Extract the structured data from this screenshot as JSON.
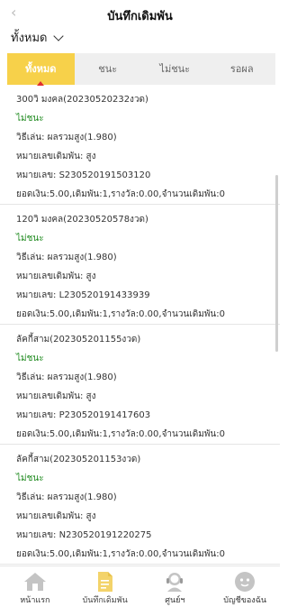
{
  "header": {
    "title": "บันทึกเดิมพัน",
    "back_icon": "chevron-left-icon"
  },
  "filter": {
    "label": "ทั้งหมด"
  },
  "tabs": [
    {
      "label": "ทั้งหมด",
      "active": true
    },
    {
      "label": "ชนะ",
      "active": false
    },
    {
      "label": "ไม่ชนะ",
      "active": false
    },
    {
      "label": "รอผล",
      "active": false
    }
  ],
  "records": [
    {
      "title": "300วิ มงคล(20230520232งวด)",
      "status": "ไม่ชนะ",
      "method": "วิธีเล่น:  ผลรวมสูง(1.980)",
      "bet_number": "หมายเลขเดิมพัน:    สูง",
      "serial": "หมายเลข:   S230520191503120",
      "summary": "ยอดเงิน:5.00,เดิมพัน:1,รางวัล:0.00,จำนวนเดิมพัน:0"
    },
    {
      "title": "120วิ มงคล(20230520578งวด)",
      "status": "ไม่ชนะ",
      "method": "วิธีเล่น:  ผลรวมสูง(1.980)",
      "bet_number": "หมายเลขเดิมพัน:    สูง",
      "serial": "หมายเลข:   L230520191433939",
      "summary": "ยอดเงิน:5.00,เดิมพัน:1,รางวัล:0.00,จำนวนเดิมพัน:0"
    },
    {
      "title": "ลัคกี้สาม(202305201155งวด)",
      "status": "ไม่ชนะ",
      "method": "วิธีเล่น:  ผลรวมสูง(1.980)",
      "bet_number": "หมายเลขเดิมพัน:    สูง",
      "serial": "หมายเลข:   P230520191417603",
      "summary": "ยอดเงิน:5.00,เดิมพัน:1,รางวัล:0.00,จำนวนเดิมพัน:0"
    },
    {
      "title": "ลัคกี้สาม(202305201153งวด)",
      "status": "ไม่ชนะ",
      "method": "วิธีเล่น:  ผลรวมสูง(1.980)",
      "bet_number": "หมายเลขเดิมพัน:    สูง",
      "serial": "หมายเลข:   N230520191220275",
      "summary": "ยอดเงิน:5.00,เดิมพัน:1,รางวัล:0.00,จำนวนเดิมพัน:0"
    }
  ],
  "nav": [
    {
      "label": "หน้าแรก",
      "icon": "home-icon"
    },
    {
      "label": "บันทึกเดิมพัน",
      "icon": "document-icon"
    },
    {
      "label": "ศูนย์ฯ",
      "icon": "support-agent-icon"
    },
    {
      "label": "บัญชีของฉัน",
      "icon": "account-face-icon"
    }
  ],
  "colors": {
    "tab_active": "#f7d14a",
    "status_lose": "#1f8a1f",
    "nav_icon": "#c4c4c4",
    "nav_active_icon": "#f3d36a"
  }
}
